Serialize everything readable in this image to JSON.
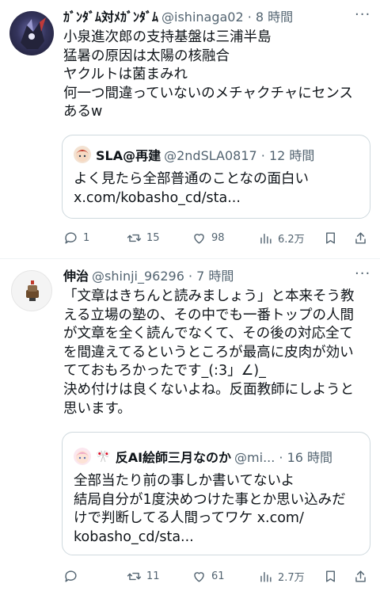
{
  "tweets": [
    {
      "display_name": "ｶﾞﾝﾀﾞﾑ対ﾒｶﾞﾝﾀﾞﾑ",
      "meta": "@ishinaga02 · 8 時間",
      "lines": [
        "小泉進次郎の支持基盤は三浦半島",
        "猛暑の原因は太陽の核融合",
        "ヤクルトは菌まみれ",
        "何一つ間違っていないのメチャクチャにセンス",
        "あるw"
      ],
      "quote": {
        "display_name": "SLA@再建",
        "meta": "@2ndSLA0817 · 12 時間",
        "lines": [
          "よく見たら全部普通のことなの面白い",
          "x.com/kobasho_cd/sta..."
        ]
      },
      "stats": {
        "replies": "1",
        "retweets": "15",
        "likes": "98",
        "views": "6.2万"
      }
    },
    {
      "display_name": "伸治",
      "meta": "@shinji_96296 · 7 時間",
      "lines": [
        "「文章はきちんと読みましょう」と本来そう教",
        "える立場の塾の、その中でも一番トップの人間",
        "が文章を全く読んでなくて、その後の対応全て",
        "を間違えてるというところが最高に皮肉が効い",
        "てておもろかったです_(:3」∠)_",
        "決め付けは良くないよね。反面教師にしようと",
        "思います。"
      ],
      "quote": {
        "display_name": "反AI絵師三月なのか",
        "meta": "@mi... · 16 時間",
        "lines": [
          "全部当たり前の事しか書いてないよ",
          "結局自分が1度決めつけた事とか思い込みだ",
          "けで判断してる人間ってワケ x.com/",
          "kobasho_cd/sta..."
        ]
      },
      "stats": {
        "replies": "",
        "retweets": "11",
        "likes": "61",
        "views": "2.7万"
      }
    }
  ],
  "colors": {
    "text": "#0f1419",
    "secondary": "#536471",
    "border": "#cfd9de"
  }
}
